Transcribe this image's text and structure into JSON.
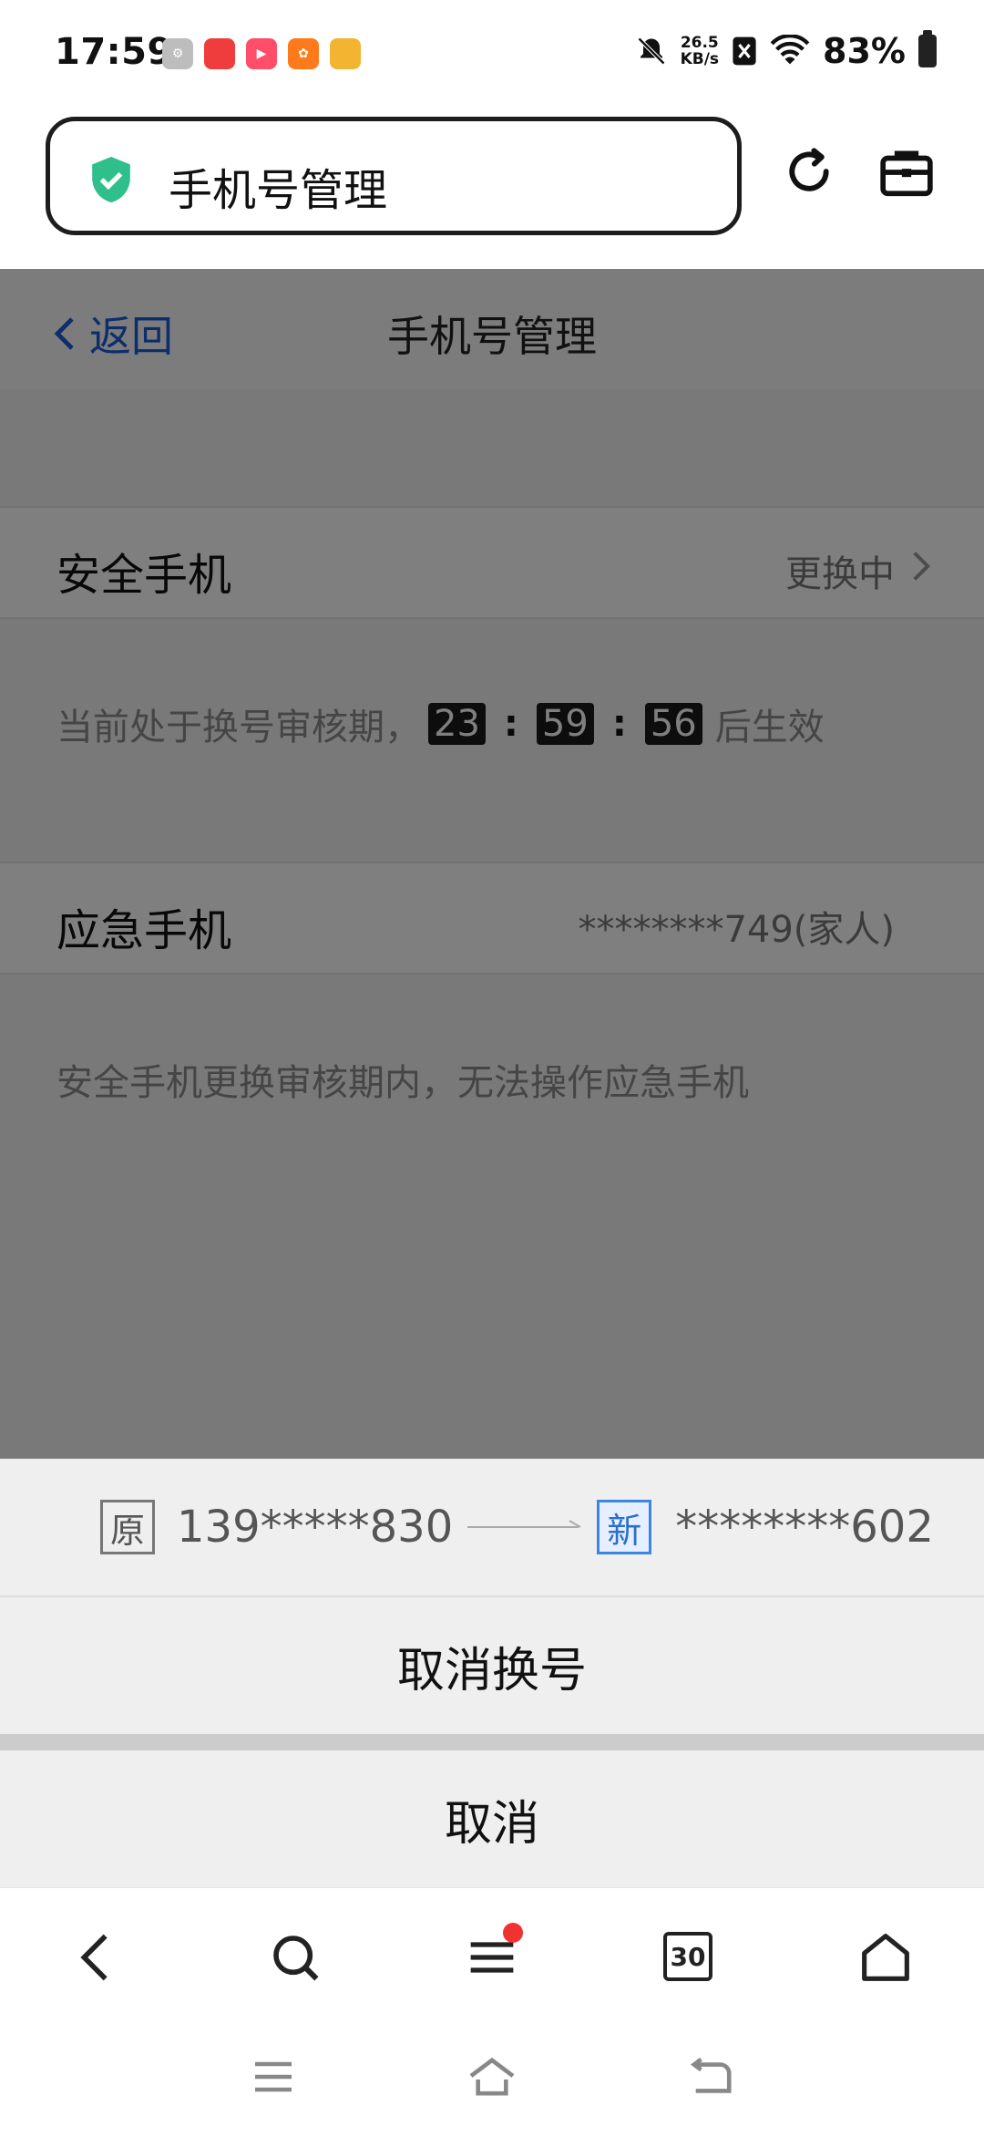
{
  "status_bar": {
    "time": "17:59",
    "net_speed_value": "26.5",
    "net_speed_unit": "KB/s",
    "battery_percent": "83%"
  },
  "browser": {
    "url_title": "手机号管理"
  },
  "page": {
    "back_label": "返回",
    "title": "手机号管理",
    "security_phone_label": "安全手机",
    "security_phone_status": "更换中",
    "countdown_prefix": "当前处于换号审核期，",
    "countdown_hours": "23",
    "countdown_minutes": "59",
    "countdown_seconds": "56",
    "countdown_suffix": "后生效",
    "emergency_phone_label": "应急手机",
    "emergency_phone_value": "********749(家人)",
    "emergency_note": "安全手机更换审核期内，无法操作应急手机"
  },
  "sheet": {
    "old_tag": "原",
    "old_number": "139*****830",
    "new_tag": "新",
    "new_number": "********602",
    "cancel_change_label": "取消换号",
    "cancel_label": "取消"
  },
  "bottom_nav": {
    "tabs_count": "30"
  },
  "colors": {
    "accent_blue": "#1c5bd8",
    "shield_green": "#2fbf8a",
    "notification_red": "#f23232"
  }
}
